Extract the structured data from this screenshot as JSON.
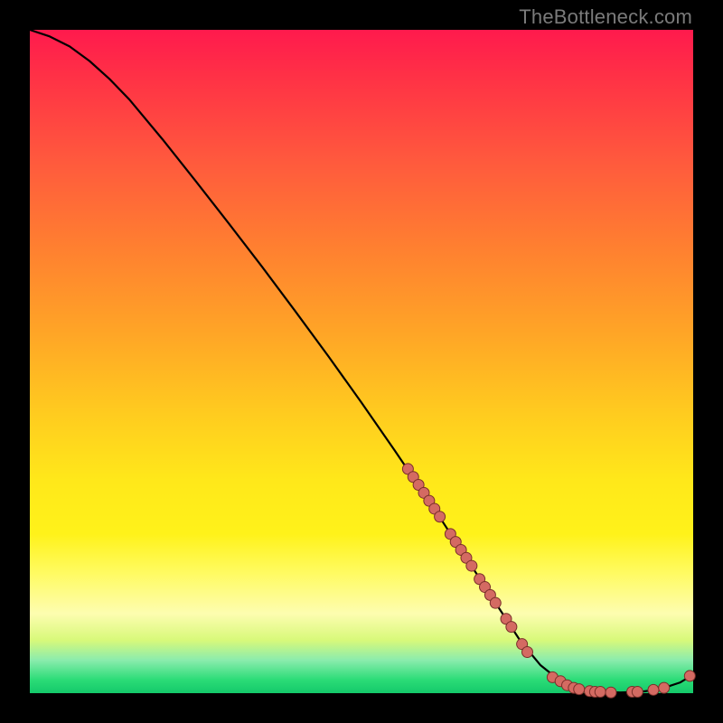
{
  "watermark": "TheBottleneck.com",
  "colors": {
    "curve": "#000000",
    "marker_fill": "#d46a62",
    "marker_stroke": "#7a2f2a",
    "background": "#000000"
  },
  "chart_data": {
    "type": "line",
    "title": "",
    "xlabel": "",
    "ylabel": "",
    "xlim": [
      0,
      100
    ],
    "ylim": [
      0,
      100
    ],
    "grid": false,
    "curve": {
      "x": [
        0,
        3,
        6,
        9,
        12,
        15,
        20,
        25,
        30,
        35,
        40,
        45,
        50,
        55,
        60,
        62,
        65,
        68,
        71,
        74,
        77,
        80,
        83,
        86,
        89,
        92,
        95,
        98,
        100
      ],
      "y": [
        100,
        99,
        97.5,
        95.3,
        92.6,
        89.5,
        83.5,
        77.2,
        70.8,
        64.3,
        57.6,
        50.8,
        43.8,
        36.6,
        29.2,
        26.2,
        21.6,
        17.0,
        12.4,
        7.8,
        4.2,
        1.8,
        0.6,
        0.2,
        0.1,
        0.2,
        0.6,
        1.6,
        2.8
      ]
    },
    "markers": [
      {
        "x": 57.0,
        "y": 33.8
      },
      {
        "x": 57.8,
        "y": 32.6
      },
      {
        "x": 58.6,
        "y": 31.4
      },
      {
        "x": 59.4,
        "y": 30.2
      },
      {
        "x": 60.2,
        "y": 29.0
      },
      {
        "x": 61.0,
        "y": 27.8
      },
      {
        "x": 61.8,
        "y": 26.6
      },
      {
        "x": 63.4,
        "y": 24.0
      },
      {
        "x": 64.2,
        "y": 22.8
      },
      {
        "x": 65.0,
        "y": 21.6
      },
      {
        "x": 65.8,
        "y": 20.4
      },
      {
        "x": 66.6,
        "y": 19.2
      },
      {
        "x": 67.8,
        "y": 17.2
      },
      {
        "x": 68.6,
        "y": 16.0
      },
      {
        "x": 69.4,
        "y": 14.8
      },
      {
        "x": 70.2,
        "y": 13.6
      },
      {
        "x": 71.8,
        "y": 11.2
      },
      {
        "x": 72.6,
        "y": 10.0
      },
      {
        "x": 74.2,
        "y": 7.4
      },
      {
        "x": 75.0,
        "y": 6.2
      },
      {
        "x": 78.8,
        "y": 2.4
      },
      {
        "x": 80.0,
        "y": 1.8
      },
      {
        "x": 81.0,
        "y": 1.2
      },
      {
        "x": 82.0,
        "y": 0.8
      },
      {
        "x": 82.8,
        "y": 0.6
      },
      {
        "x": 84.4,
        "y": 0.3
      },
      {
        "x": 85.2,
        "y": 0.2
      },
      {
        "x": 86.0,
        "y": 0.2
      },
      {
        "x": 87.6,
        "y": 0.1
      },
      {
        "x": 90.8,
        "y": 0.2
      },
      {
        "x": 91.6,
        "y": 0.2
      },
      {
        "x": 94.0,
        "y": 0.5
      },
      {
        "x": 95.6,
        "y": 0.8
      },
      {
        "x": 99.5,
        "y": 2.6
      }
    ]
  }
}
